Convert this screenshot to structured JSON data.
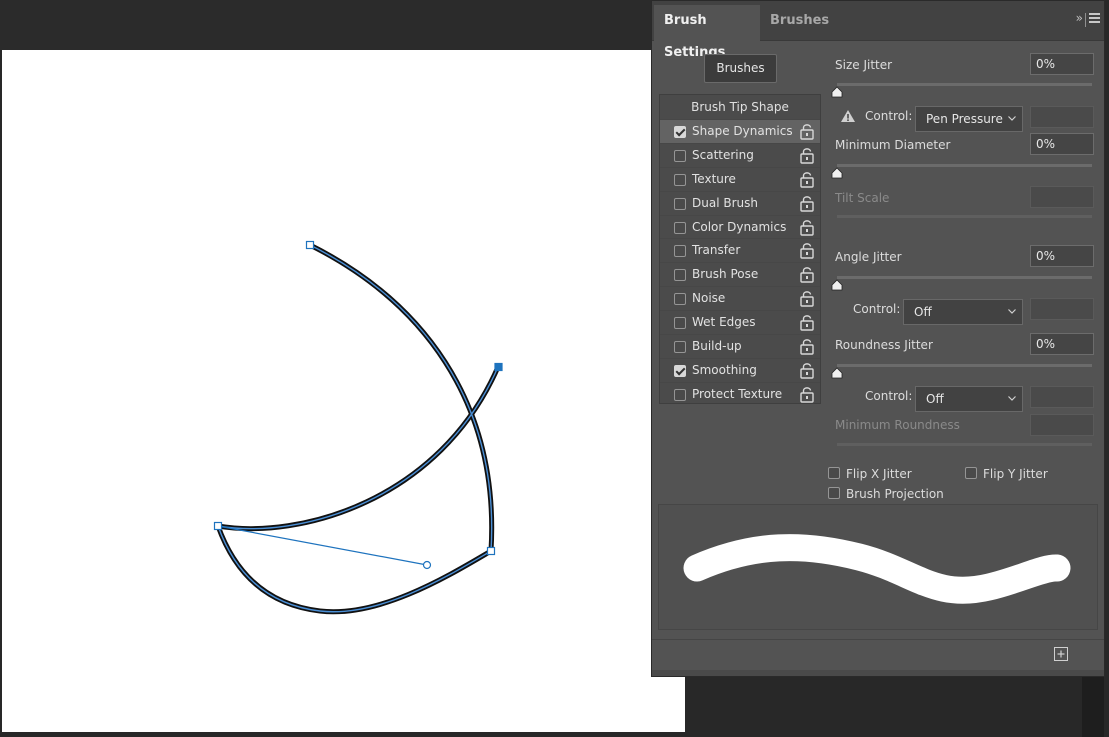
{
  "panel": {
    "tabs": [
      "Brush Settings",
      "Brushes"
    ],
    "collapse_glyph": "»",
    "brushes_button": "Brushes",
    "list_title": "Brush Tip Shape",
    "list_items": [
      {
        "label": "Shape Dynamics",
        "checked": true,
        "selected": true
      },
      {
        "label": "Scattering",
        "checked": false
      },
      {
        "label": "Texture",
        "checked": false
      },
      {
        "label": "Dual Brush",
        "checked": false
      },
      {
        "label": "Color Dynamics",
        "checked": false
      },
      {
        "label": "Transfer",
        "checked": false
      },
      {
        "label": "Brush Pose",
        "checked": false
      },
      {
        "label": "Noise",
        "checked": false
      },
      {
        "label": "Wet Edges",
        "checked": false
      },
      {
        "label": "Build-up",
        "checked": false
      },
      {
        "label": "Smoothing",
        "checked": true
      },
      {
        "label": "Protect Texture",
        "checked": false
      }
    ],
    "size_jitter": {
      "label": "Size Jitter",
      "value": "0%"
    },
    "size_control": {
      "label": "Control:",
      "value": "Pen Pressure"
    },
    "min_diameter": {
      "label": "Minimum Diameter",
      "value": "0%"
    },
    "tilt_scale": {
      "label": "Tilt Scale"
    },
    "angle_jitter": {
      "label": "Angle Jitter",
      "value": "0%"
    },
    "angle_control": {
      "label": "Control:",
      "value": "Off"
    },
    "roundness_jitter": {
      "label": "Roundness Jitter",
      "value": "0%"
    },
    "roundness_control": {
      "label": "Control:",
      "value": "Off"
    },
    "min_roundness": {
      "label": "Minimum Roundness"
    },
    "flip_x": "Flip X Jitter",
    "flip_y": "Flip Y Jitter",
    "brush_projection": "Brush Projection"
  },
  "colors": {
    "path_blue": "#1e73be",
    "stroke_black": "#111111",
    "panel_bg": "#535353"
  }
}
